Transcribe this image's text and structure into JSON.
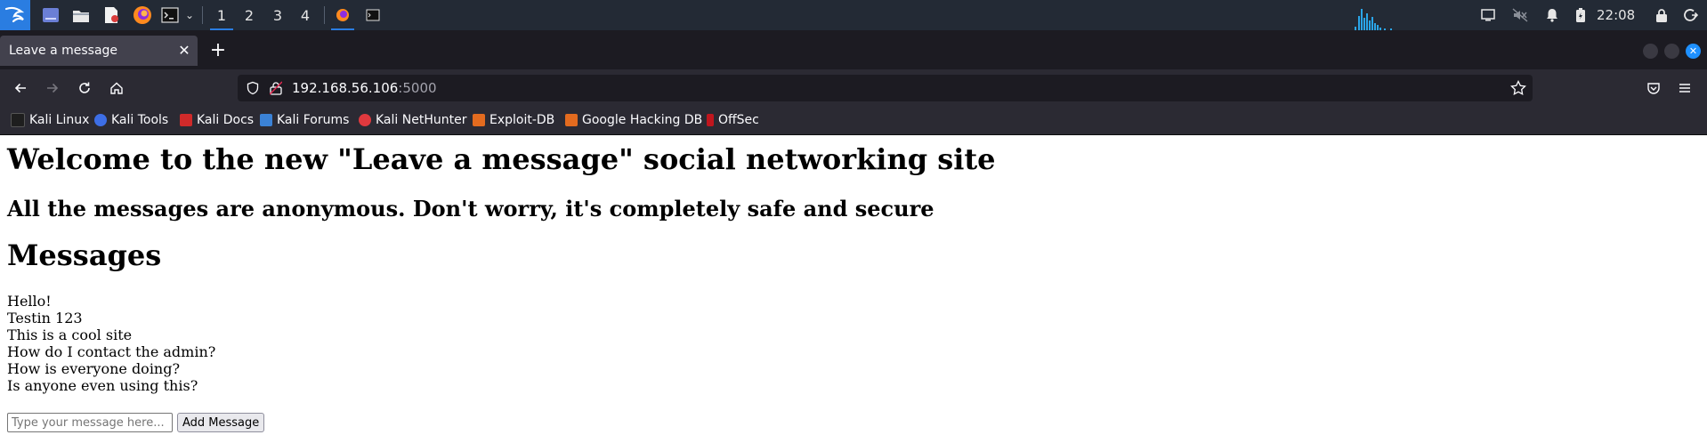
{
  "taskbar": {
    "workspaces": [
      "1",
      "2",
      "3",
      "4"
    ],
    "active_workspace": "1",
    "clock": "22:08"
  },
  "browser": {
    "tab_title": "Leave a message",
    "url_host": "192.168.56.106",
    "url_port": ":5000",
    "bookmarks": [
      "Kali Linux",
      "Kali Tools",
      "Kali Docs",
      "Kali Forums",
      "Kali NetHunter",
      "Exploit-DB",
      "Google Hacking DB",
      "OffSec"
    ]
  },
  "page": {
    "heading": "Welcome to the new \"Leave a message\" social networking site",
    "subheading": "All the messages are anonymous. Don't worry, it's completely safe and secure",
    "messages_title": "Messages",
    "messages": [
      "Hello!",
      "Testin 123",
      "This is a cool site",
      "How do I contact the admin?",
      "How is everyone doing?",
      "Is anyone even using this?"
    ],
    "input_placeholder": "Type your message here...",
    "input_value": "",
    "add_button_label": "Add Message"
  },
  "colors": {
    "taskbar_bg": "#232a35",
    "accent": "#2a7de1",
    "tabstrip_bg": "#1c1b22",
    "toolbar_bg": "#2b2a33"
  }
}
